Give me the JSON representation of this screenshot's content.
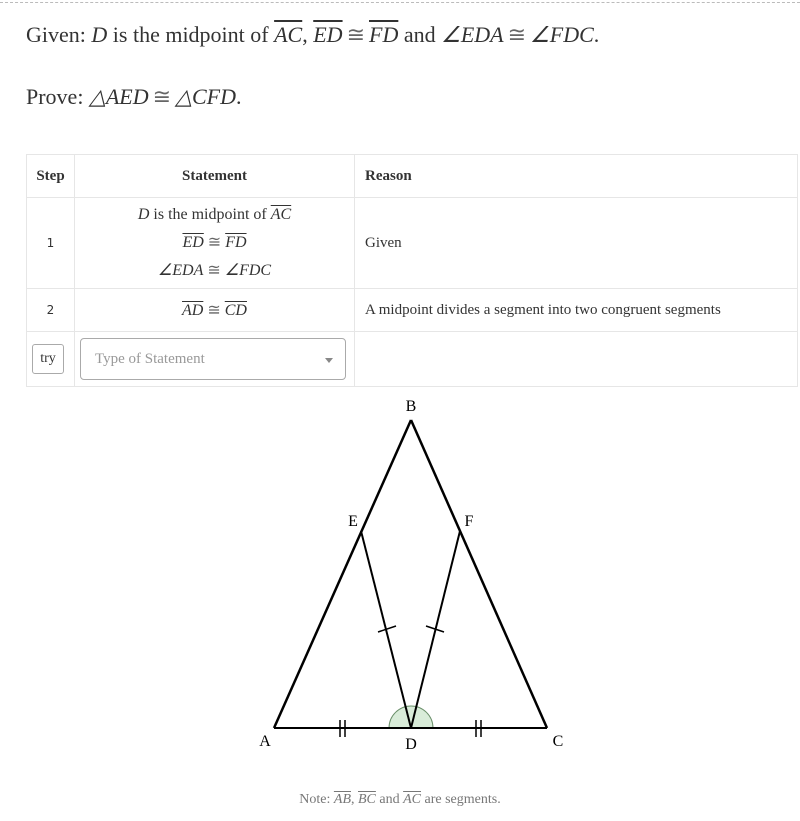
{
  "given": {
    "prefix": "Given: ",
    "d": "D",
    "text1": " is the midpoint of ",
    "seg_ac": "AC",
    "comma": ", ",
    "seg_ed": "ED",
    "cong": "≅",
    "seg_fd": "FD",
    "and": " and ",
    "angle_eda": "∠EDA",
    "angle_fdc": "∠FDC",
    "period": "."
  },
  "prove": {
    "prefix": "Prove: ",
    "tri_aed": "△AED",
    "cong": "≅",
    "tri_cfd": "△CFD",
    "period": "."
  },
  "table": {
    "headers": {
      "step": "Step",
      "statement": "Statement",
      "reason": "Reason"
    },
    "rows": [
      {
        "step": "1",
        "statement": {
          "line1": {
            "d": "D",
            "text": " is the midpoint of ",
            "seg": "AC"
          },
          "line2": {
            "a": "ED",
            "cong": "≅",
            "b": "FD"
          },
          "line3": {
            "a": "∠EDA",
            "cong": "≅",
            "b": "∠FDC"
          }
        },
        "reason": "Given"
      },
      {
        "step": "2",
        "statement": {
          "a": "AD",
          "cong": "≅",
          "b": "CD"
        },
        "reason": "A midpoint divides a segment into two congruent segments"
      }
    ],
    "input_row": {
      "try_label": "try",
      "select_placeholder": "Type of Statement"
    }
  },
  "diagram": {
    "labels": {
      "A": "A",
      "B": "B",
      "C": "C",
      "D": "D",
      "E": "E",
      "F": "F"
    },
    "angle_fill": "#d9ecd9",
    "line_color": "#000000"
  },
  "note": {
    "prefix": "Note: ",
    "seg_ab": "AB",
    "comma": ", ",
    "seg_bc": "BC",
    "and": " and ",
    "seg_ac": "AC",
    "suffix": " are segments."
  }
}
